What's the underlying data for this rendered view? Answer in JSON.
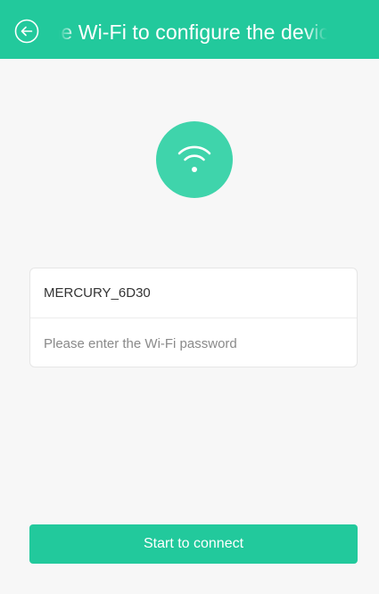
{
  "header": {
    "title": "Select the Wi-Fi to configure the device",
    "back_icon": "back-arrow-circle-icon"
  },
  "wifi": {
    "icon": "wifi-icon"
  },
  "form": {
    "ssid": "MERCURY_6D30",
    "password_placeholder": "Please enter the Wi-Fi password",
    "password_value": ""
  },
  "actions": {
    "connect_label": "Start to connect"
  },
  "colors": {
    "accent": "#22c99c",
    "icon_circle": "#3fd4ab",
    "background": "#f7f7f7"
  }
}
